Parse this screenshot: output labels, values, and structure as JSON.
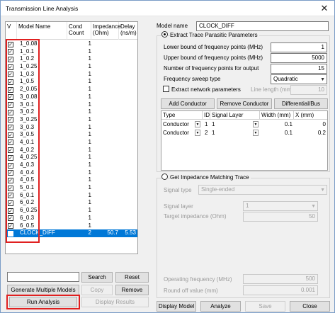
{
  "window": {
    "title": "Transmission Line Analysis",
    "close_glyph": "✕"
  },
  "list": {
    "headers": {
      "v": "V",
      "name": "Model Name",
      "count": "Cond Count",
      "impedance": "Impedance (Ohm)",
      "delay": "Delay (ns/m)"
    },
    "rows": [
      {
        "name": "1_0.08",
        "count": "1",
        "impedance": "",
        "delay": "",
        "checked": true
      },
      {
        "name": "1_0.1",
        "count": "1",
        "impedance": "",
        "delay": "",
        "checked": true
      },
      {
        "name": "1_0.2",
        "count": "1",
        "impedance": "",
        "delay": "",
        "checked": true
      },
      {
        "name": "1_0.25",
        "count": "1",
        "impedance": "",
        "delay": "",
        "checked": true
      },
      {
        "name": "1_0.3",
        "count": "1",
        "impedance": "",
        "delay": "",
        "checked": true
      },
      {
        "name": "1_0.5",
        "count": "1",
        "impedance": "",
        "delay": "",
        "checked": true
      },
      {
        "name": "2_0.05",
        "count": "1",
        "impedance": "",
        "delay": "",
        "checked": true
      },
      {
        "name": "3_0.08",
        "count": "1",
        "impedance": "",
        "delay": "",
        "checked": true
      },
      {
        "name": "3_0.1",
        "count": "1",
        "impedance": "",
        "delay": "",
        "checked": true
      },
      {
        "name": "3_0.2",
        "count": "1",
        "impedance": "",
        "delay": "",
        "checked": true
      },
      {
        "name": "3_0.25",
        "count": "1",
        "impedance": "",
        "delay": "",
        "checked": true
      },
      {
        "name": "3_0.3",
        "count": "1",
        "impedance": "",
        "delay": "",
        "checked": true
      },
      {
        "name": "3_0.5",
        "count": "1",
        "impedance": "",
        "delay": "",
        "checked": true
      },
      {
        "name": "4_0.1",
        "count": "1",
        "impedance": "",
        "delay": "",
        "checked": true
      },
      {
        "name": "4_0.2",
        "count": "1",
        "impedance": "",
        "delay": "",
        "checked": true
      },
      {
        "name": "4_0.25",
        "count": "1",
        "impedance": "",
        "delay": "",
        "checked": true
      },
      {
        "name": "4_0.3",
        "count": "1",
        "impedance": "",
        "delay": "",
        "checked": true
      },
      {
        "name": "4_0.4",
        "count": "1",
        "impedance": "",
        "delay": "",
        "checked": true
      },
      {
        "name": "4_0.5",
        "count": "1",
        "impedance": "",
        "delay": "",
        "checked": true
      },
      {
        "name": "5_0.1",
        "count": "1",
        "impedance": "",
        "delay": "",
        "checked": true
      },
      {
        "name": "6_0.1",
        "count": "1",
        "impedance": "",
        "delay": "",
        "checked": true
      },
      {
        "name": "6_0.2",
        "count": "1",
        "impedance": "",
        "delay": "",
        "checked": true
      },
      {
        "name": "6_0.25",
        "count": "1",
        "impedance": "",
        "delay": "",
        "checked": true
      },
      {
        "name": "6_0.3",
        "count": "1",
        "impedance": "",
        "delay": "",
        "checked": true
      },
      {
        "name": "6_0.5",
        "count": "1",
        "impedance": "",
        "delay": "",
        "checked": true
      },
      {
        "name": "CLOCK_DIFF",
        "count": "2",
        "impedance": "50.7",
        "delay": "5.53",
        "checked": false,
        "selected": true
      }
    ],
    "check_glyph": "✓"
  },
  "left_buttons": {
    "search_value": "",
    "search": "Search",
    "reset": "Reset",
    "generate": "Generate Multiple Models",
    "copy": "Copy",
    "remove": "Remove",
    "run": "Run Analysis",
    "display_results": "Display Results"
  },
  "right": {
    "model_name_label": "Model name",
    "model_name_value": "CLOCK_DIFF",
    "extract_label": "Extract Trace Parasitic Parameters",
    "lower_label": "Lower bound of frequency points (MHz)",
    "lower_value": "1",
    "upper_label": "Upper bound of frequency points (MHz)",
    "upper_value": "5000",
    "num_label": "Number of frequency points for output",
    "num_value": "15",
    "sweep_label": "Frequency sweep type",
    "sweep_value": "Quadratic",
    "extract_net_label": "Extract network parameters",
    "line_length_label": "Line length (mm)",
    "line_length_value": "10",
    "add_conductor": "Add Conductor",
    "remove_conductor": "Remove Conductor",
    "diff_bus": "Differential/Bus Lines",
    "cond_headers": {
      "type": "Type",
      "id": "ID",
      "signal_layer": "Signal Layer",
      "width": "Width (mm)",
      "x": "X (mm)"
    },
    "conductors": [
      {
        "type": "Conductor",
        "id": "1",
        "layer": "1",
        "width": "0.1",
        "x": "0"
      },
      {
        "type": "Conductor",
        "id": "2",
        "layer": "1",
        "width": "0.1",
        "x": "0.2"
      }
    ],
    "impedance_label": "Get Impedance Matching Trace",
    "signal_type_label": "Signal type",
    "signal_type_value": "Single-ended",
    "signal_layer_label": "Signal layer",
    "signal_layer_value": "1",
    "target_label": "Target impedance (Ohm)",
    "target_value": "50",
    "op_freq_label": "Operating frequency (MHz)",
    "op_freq_value": "500",
    "roundoff_label": "Round off value (mm)",
    "roundoff_value": "0.001",
    "display_model": "Display Model",
    "analyze": "Analyze",
    "save": "Save",
    "close": "Close"
  },
  "colors": {
    "selection": "#0078d7",
    "highlight_box": "#e02020"
  }
}
